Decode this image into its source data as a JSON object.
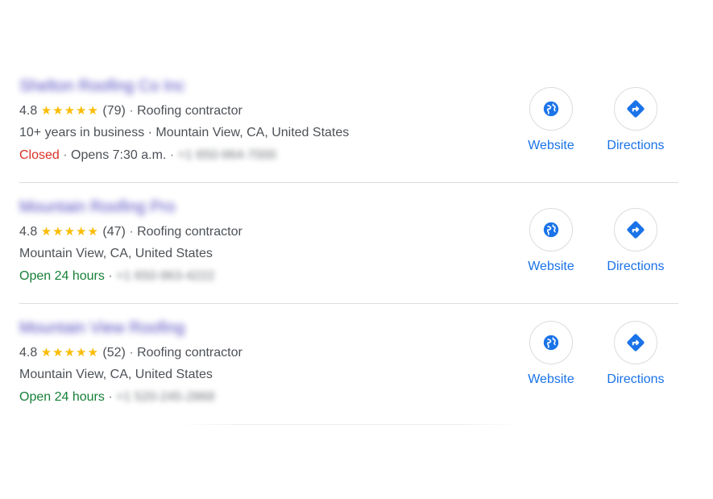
{
  "listings": [
    {
      "name": "Shelton Roofing Co Inc",
      "rating": "4.8",
      "stars": "★★★★★",
      "reviews": "(79)",
      "category": "Roofing contractor",
      "line2": "10+ years in business · Mountain View, CA, United States",
      "status": "Closed",
      "status_type": "closed",
      "hours_extra": "Opens 7:30 a.m.",
      "phone": "+1 650-964-7000",
      "website_label": "Website",
      "directions_label": "Directions"
    },
    {
      "name": "Mountain Roofing Pro",
      "rating": "4.8",
      "stars": "★★★★★",
      "reviews": "(47)",
      "category": "Roofing contractor",
      "line2": "Mountain View, CA, United States",
      "status": "Open 24 hours",
      "status_type": "open",
      "hours_extra": "",
      "phone": "+1 650-963-4222",
      "website_label": "Website",
      "directions_label": "Directions"
    },
    {
      "name": "Mountain View Roofing",
      "rating": "4.8",
      "stars": "★★★★★",
      "reviews": "(52)",
      "category": "Roofing contractor",
      "line2": "Mountain View, CA, United States",
      "status": "Open 24 hours",
      "status_type": "open",
      "hours_extra": "",
      "phone": "+1 520-245-2868",
      "website_label": "Website",
      "directions_label": "Directions"
    }
  ],
  "separator": "·",
  "icons": {
    "website": "globe-icon",
    "directions": "directions-icon"
  },
  "colors": {
    "accent": "#1a73e8",
    "star": "#fbbc04",
    "closed": "#d93025",
    "open": "#188038",
    "text": "#4d5156"
  }
}
